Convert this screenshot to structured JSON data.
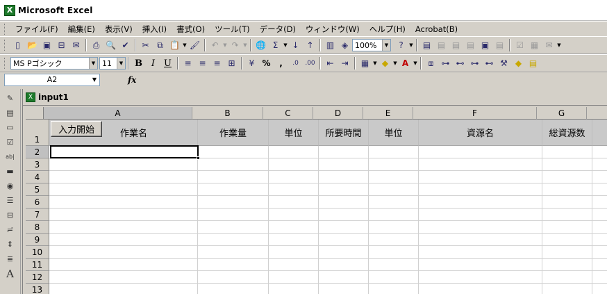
{
  "app": {
    "title": "Microsoft Excel",
    "icon": "excel-icon"
  },
  "menubar": [
    "ファイル(F)",
    "編集(E)",
    "表示(V)",
    "挿入(I)",
    "書式(O)",
    "ツール(T)",
    "データ(D)",
    "ウィンドウ(W)",
    "ヘルプ(H)",
    "Acrobat(B)"
  ],
  "standard_toolbar": {
    "zoom": "100%"
  },
  "formatting_toolbar": {
    "font_name": "MS Pゴシック",
    "font_size": "11",
    "bold": "B",
    "italic": "I",
    "underline": "U",
    "percent": "%",
    "comma": ","
  },
  "formula_bar": {
    "name_box": "A2",
    "fx": "fx",
    "content": ""
  },
  "workbook": {
    "title": "input1",
    "columns": [
      "A",
      "B",
      "C",
      "D",
      "E",
      "F",
      "G"
    ],
    "rows": [
      "1",
      "2",
      "3",
      "4",
      "5",
      "6",
      "7",
      "8",
      "9",
      "10",
      "11",
      "12",
      "13"
    ],
    "header_cells": [
      "作業名",
      "作業量",
      "単位",
      "所要時間",
      "単位",
      "資源名",
      "総資源数"
    ],
    "start_button": "入力開始",
    "active_cell": "A2"
  },
  "colors": {
    "header_fill": "#c9c9c9",
    "chrome": "#d4d0c8",
    "excel_green": "#1d7a2b"
  }
}
